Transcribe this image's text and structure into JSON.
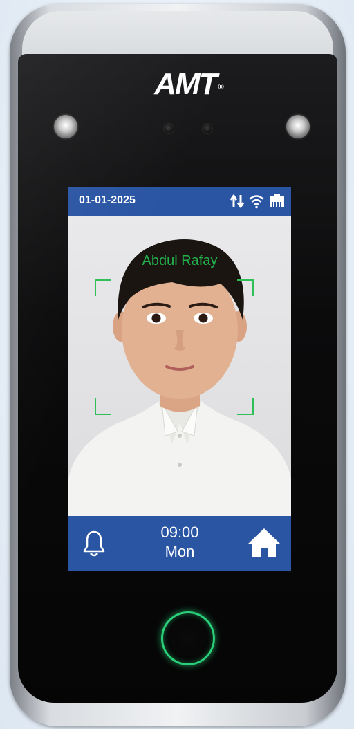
{
  "device": {
    "brand": "AMT",
    "brand_mark": "®"
  },
  "screen": {
    "date": "01-01-2025",
    "status_icons": [
      "data-transfer-icon",
      "wifi-icon",
      "ethernet-icon"
    ],
    "recognized_name": "Abdul Rafay",
    "time": "09:00",
    "day": "Mon",
    "colors": {
      "bar": "#2a55a3",
      "face_frame": "#2fbf58",
      "name_text": "#22b24c",
      "fingerprint_ring": "#2ad07a"
    }
  }
}
